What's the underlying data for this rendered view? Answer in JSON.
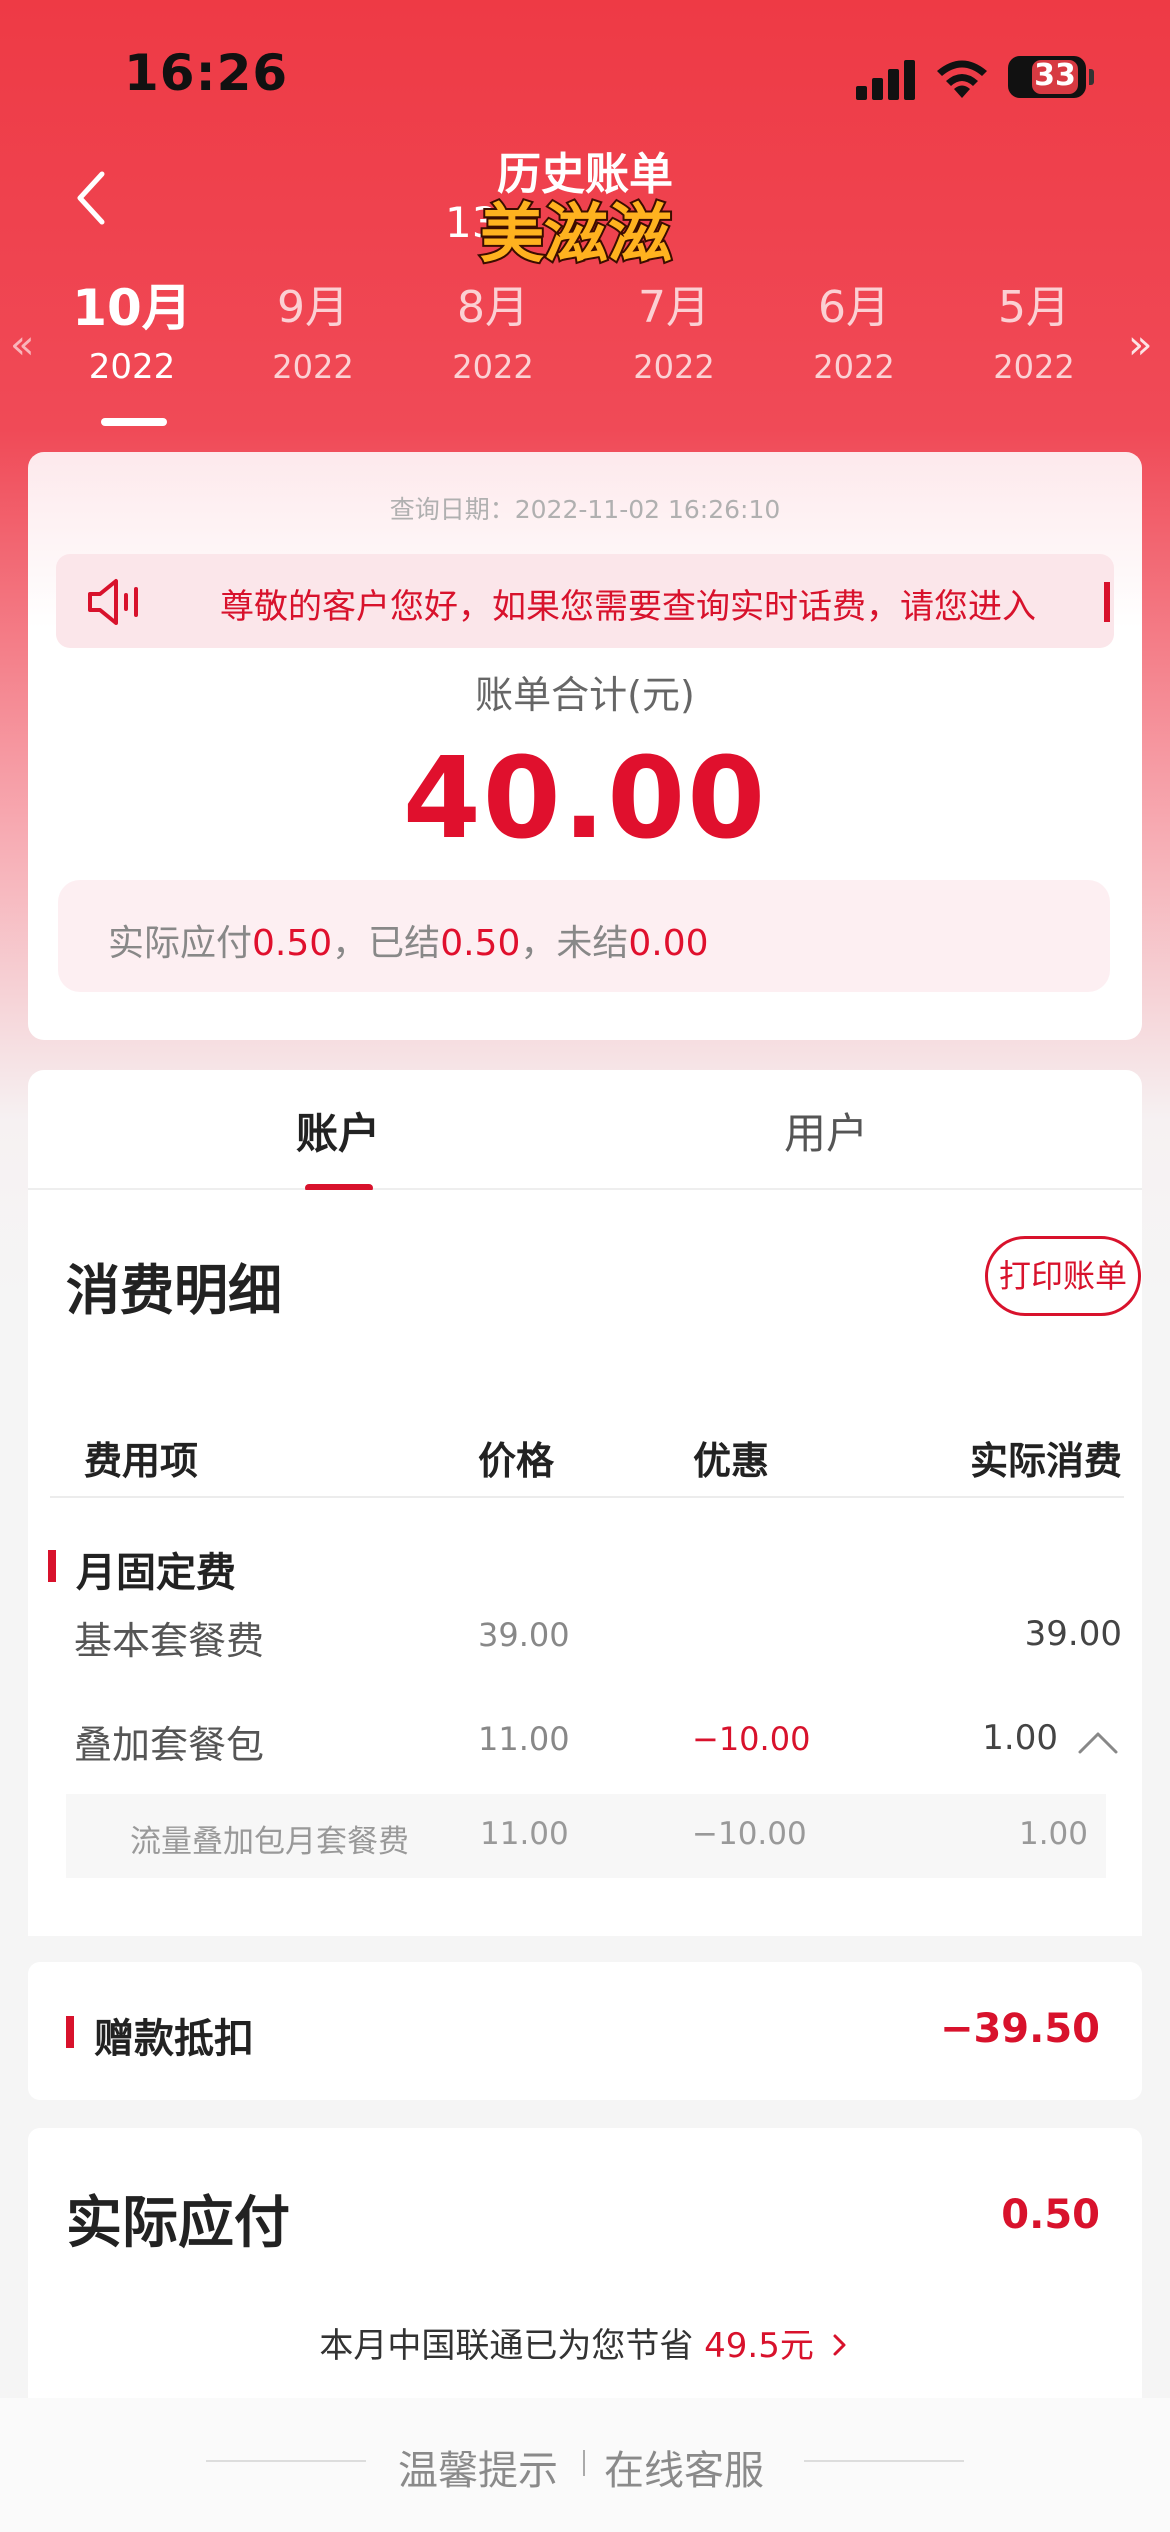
{
  "status_bar": {
    "time": "16:26",
    "battery": "33"
  },
  "header": {
    "title": "历史账单",
    "subtitle_fragment": "13",
    "sticker_text": "美滋滋"
  },
  "months": [
    {
      "month": "10月",
      "year": "2022",
      "active": true
    },
    {
      "month": "9月",
      "year": "2022"
    },
    {
      "month": "8月",
      "year": "2022"
    },
    {
      "month": "7月",
      "year": "2022"
    },
    {
      "month": "6月",
      "year": "2022"
    },
    {
      "month": "5月",
      "year": "2022"
    }
  ],
  "nav_arrows": {
    "left": "«",
    "right": "»"
  },
  "bill": {
    "query_date": "查询日期：2022-11-02 16:26:10",
    "notice": "尊敬的客户您好，如果您需要查询实时话费，请您进入",
    "total_label": "账单合计(元)",
    "total_value": "40.00",
    "summary": {
      "payable_label": "实际应付",
      "payable_value": "0.50",
      "settled_label": "，已结",
      "settled_value": "0.50",
      "unsettled_label": "，未结",
      "unsettled_value": "0.00"
    }
  },
  "tabs": {
    "account": "账户",
    "user": "用户"
  },
  "detail": {
    "title": "消费明细",
    "print_button": "打印账单",
    "headers": {
      "item": "费用项",
      "price": "价格",
      "discount": "优惠",
      "actual": "实际消费"
    },
    "group_title": "月固定费",
    "rows": [
      {
        "name": "基本套餐费",
        "price": "39.00",
        "discount": "",
        "actual": "39.00"
      },
      {
        "name": "叠加套餐包",
        "price": "11.00",
        "discount": "−10.00",
        "actual": "1.00"
      }
    ],
    "sub_row": {
      "name": "流量叠加包月套餐费",
      "price": "11.00",
      "discount": "−10.00",
      "actual": "1.00"
    }
  },
  "discount": {
    "label": "赠款抵扣",
    "value": "−39.50"
  },
  "payable": {
    "label": "实际应付",
    "value": "0.50",
    "saving_prefix": "本月中国联通已为您节省",
    "saving_value": "49.5元"
  },
  "footer": {
    "tips": "温馨提示",
    "service": "在线客服"
  },
  "colors": {
    "brand_red": "#d8122c",
    "header_red": "#ee3a45"
  },
  "icons": [
    "back-icon",
    "speaker-icon",
    "caret-up-icon",
    "chevron-right-icon",
    "wifi-icon",
    "signal-icon",
    "battery-icon"
  ]
}
